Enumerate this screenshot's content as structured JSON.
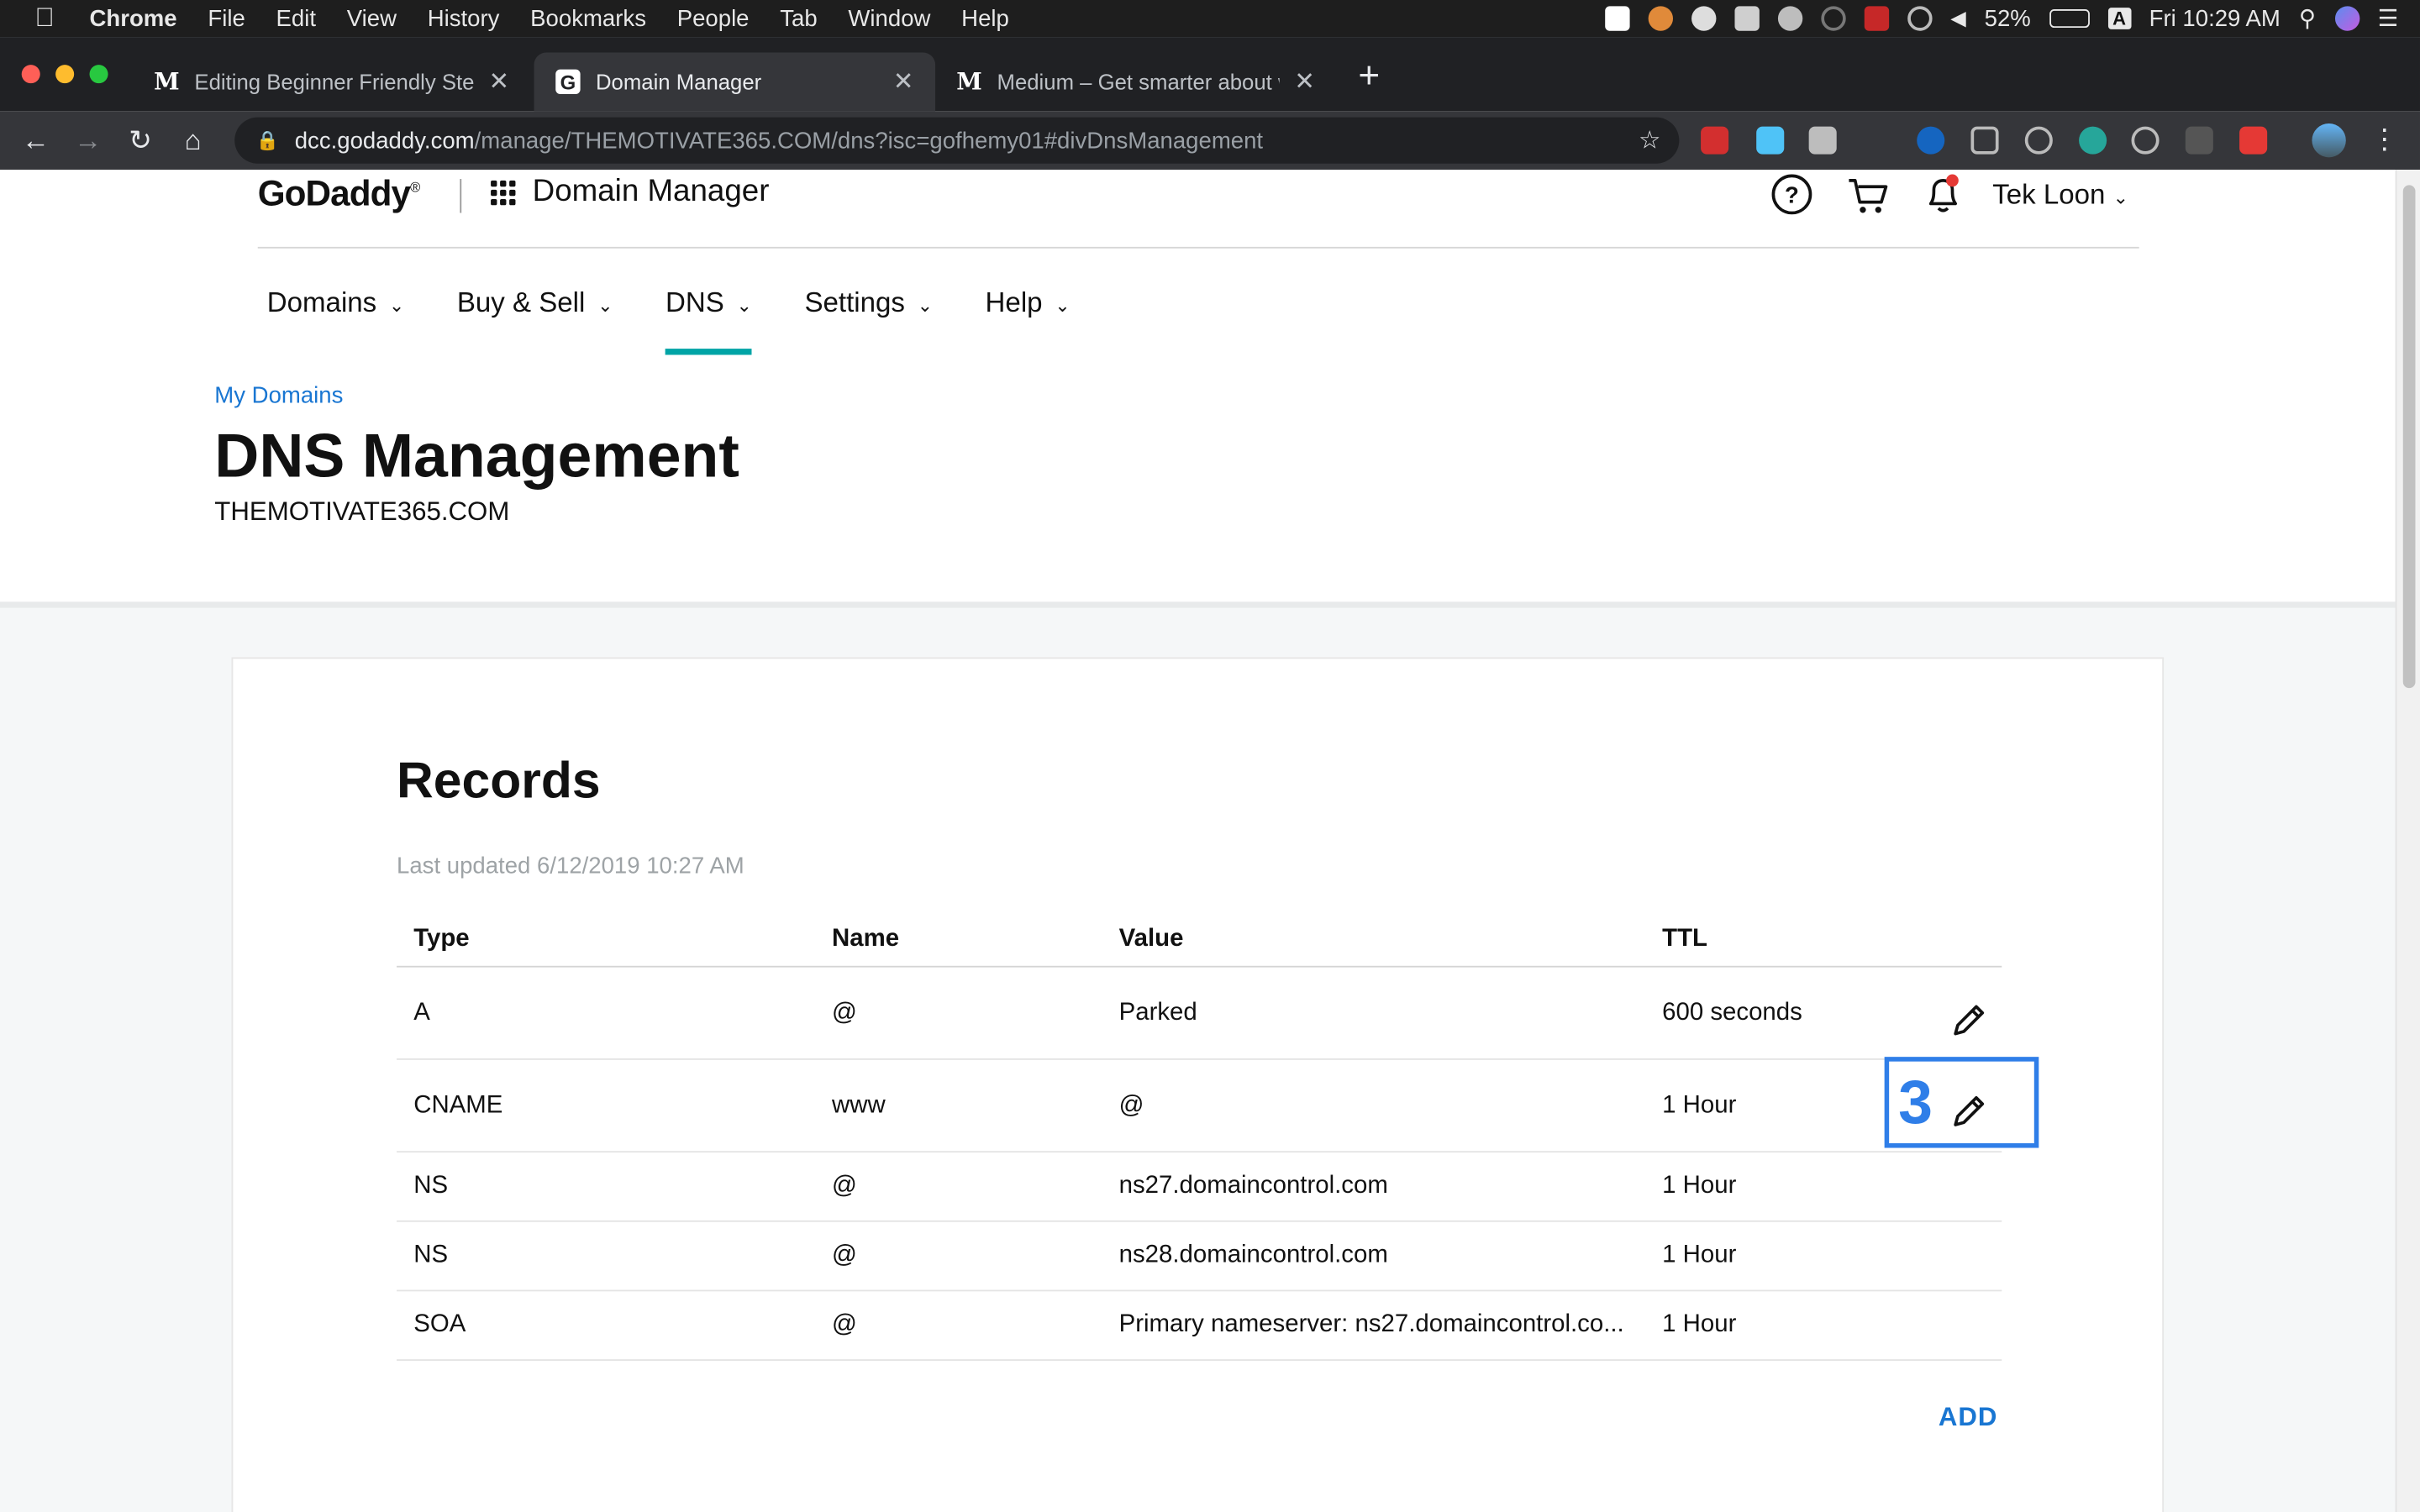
{
  "menubar": {
    "app": "Chrome",
    "items": [
      "File",
      "Edit",
      "View",
      "History",
      "Bookmarks",
      "People",
      "Tab",
      "Window",
      "Help"
    ],
    "battery": "52%",
    "input_source": "A",
    "clock": "Fri 10:29 AM"
  },
  "tabs": [
    {
      "title": "Editing Beginner Friendly Step",
      "favicon": "M"
    },
    {
      "title": "Domain Manager",
      "favicon": "G"
    },
    {
      "title": "Medium – Get smarter about w",
      "favicon": "M"
    }
  ],
  "omnibox": {
    "host": "dcc.godaddy.com",
    "path": "/manage/THEMOTIVATE365.COM/dns?isc=gofhemy01#divDnsManagement"
  },
  "header": {
    "logo": "GoDaddy",
    "title": "Domain Manager",
    "user": "Tek Loon"
  },
  "nav": [
    {
      "label": "Domains",
      "active": false
    },
    {
      "label": "Buy & Sell",
      "active": false
    },
    {
      "label": "DNS",
      "active": true
    },
    {
      "label": "Settings",
      "active": false
    },
    {
      "label": "Help",
      "active": false
    }
  ],
  "breadcrumb": "My Domains",
  "page_title": "DNS Management",
  "domain_name": "THEMOTIVATE365.COM",
  "records": {
    "heading": "Records",
    "last_updated": "Last updated 6/12/2019 10:27 AM",
    "columns": [
      "Type",
      "Name",
      "Value",
      "TTL"
    ],
    "rows": [
      {
        "type": "A",
        "name": "@",
        "value": "Parked",
        "ttl": "600 seconds",
        "editable": true
      },
      {
        "type": "CNAME",
        "name": "www",
        "value": "@",
        "ttl": "1 Hour",
        "editable": true,
        "annotation": "3"
      },
      {
        "type": "NS",
        "name": "@",
        "value": "ns27.domaincontrol.com",
        "ttl": "1 Hour",
        "editable": false
      },
      {
        "type": "NS",
        "name": "@",
        "value": "ns28.domaincontrol.com",
        "ttl": "1 Hour",
        "editable": false
      },
      {
        "type": "SOA",
        "name": "@",
        "value": "Primary nameserver: ns27.domaincontrol.co...",
        "ttl": "1 Hour",
        "editable": false
      }
    ],
    "add_label": "ADD"
  },
  "colors": {
    "accent_teal": "#00a4a6",
    "link_blue": "#1976d2",
    "annotation_blue": "#2f7ee8"
  }
}
